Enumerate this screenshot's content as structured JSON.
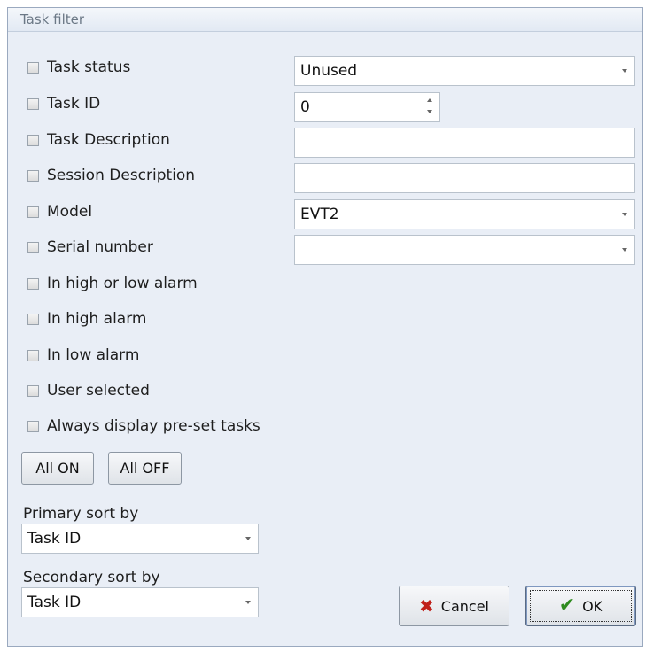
{
  "window": {
    "title": "Task filter"
  },
  "filters": [
    {
      "label": "Task status",
      "checked": false
    },
    {
      "label": "Task ID",
      "checked": false
    },
    {
      "label": "Task Description",
      "checked": false
    },
    {
      "label": "Session Description",
      "checked": false
    },
    {
      "label": "Model",
      "checked": false
    },
    {
      "label": "Serial number",
      "checked": false
    },
    {
      "label": "In high or low alarm",
      "checked": false
    },
    {
      "label": "In high alarm",
      "checked": false
    },
    {
      "label": "In low alarm",
      "checked": false
    },
    {
      "label": "User selected",
      "checked": false
    },
    {
      "label": "Always display pre-set tasks",
      "checked": false
    }
  ],
  "fields": {
    "task_status": "Unused",
    "task_id": "0",
    "task_description": "",
    "session_description": "",
    "model": "EVT2",
    "serial_number": ""
  },
  "buttons": {
    "all_on": "All ON",
    "all_off": "All OFF",
    "cancel": "Cancel",
    "ok": "OK"
  },
  "sort": {
    "primary_label": "Primary sort by",
    "primary_value": "Task ID",
    "secondary_label": "Secondary sort by",
    "secondary_value": "Task ID"
  },
  "icons": {
    "cancel": "x-icon",
    "ok": "checkmark-icon"
  },
  "colors": {
    "cancel_icon": "#c0201b",
    "ok_icon": "#2e8b1f"
  }
}
